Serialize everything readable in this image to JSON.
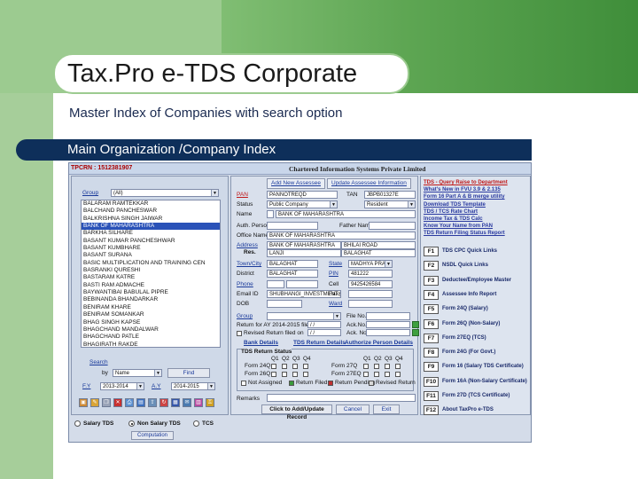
{
  "slide": {
    "title": "Tax.Pro e-TDS Corporate",
    "subtitle": "Master Index of Companies with search option",
    "section": "Main Organization /Company Index"
  },
  "app": {
    "tpcrn": "TPCRN : 1512381907",
    "company": "Chartered Information Systems Private Limited",
    "left": {
      "group_label": "Group",
      "group_value": "(All)",
      "companies": [
        "BALARAM RAMTEKKAR",
        "BALCHAND PANCHESWAR",
        "BALKRISHNA  SINGH JAIWAR",
        "BANK OF MAHARASHTRA",
        "BARKHA SILHARE",
        "BASANT KUMAR PANCHESHWAR",
        "BASANT KUMBHARE",
        "BASANT SURANA",
        "BASIC MULTIPLICATION AND TRAINING CEN",
        "BASRANKI QURESHI",
        "BASTARAM KATRE",
        "BASTI RAM ADMACHE",
        "BAYWANTIBAI BABULAL PIPRE",
        "BEBINANDA BHANDARKAR",
        "BENIRAM KHARE",
        "BENIRAM SOMANKAR",
        "BHAG SINGH KAPSE",
        "BHAGCHAND MANDALWAR",
        "BHAGCHAND PATLE",
        "BHAGIRATH RAKDE"
      ],
      "selected_index": 3,
      "search_label": "Search",
      "by_label": "by",
      "by_value": "Name",
      "find_label": "Find",
      "fy_label": "F.Y",
      "fy_value": "2013-2014",
      "ay_label": "A.Y",
      "ay_value": "2014-2015",
      "radios": [
        "Salary TDS",
        "Non Salary TDS",
        "TCS"
      ],
      "radio_selected": 1,
      "computation_label": "Computation"
    },
    "mid": {
      "tab_add": "Add New Assessee",
      "tab_update": "Update Assessee Information",
      "pan_label": "PAN",
      "pan_value": "PANNOTREQD",
      "tan_label": "TAN",
      "tan_value": "JBPB01327E",
      "status_label": "Status",
      "status_value": "Public Company",
      "resident_value": "Resident",
      "name_label": "Name",
      "name_value": "BANK OF MAHARASHTRA",
      "auth_label": "Auth. Person",
      "father_label": "Father Name",
      "office_label": "Office Name",
      "office_value": "BANK OF MAHARASHTRA",
      "address_label": "Address",
      "res_label": "Res.",
      "address_value": "BANK OF MAHARASHTRA",
      "address2_value": "BHILAI ROAD",
      "address3_value": "LANJI",
      "address4_value": "BALAGHAT",
      "town_label": "Town/City",
      "town_value": "BALAGHAT",
      "state_label": "State",
      "state_value": "MADHYA PRAD",
      "district_label": "District",
      "district_value": "BALAGHAT",
      "pin_label": "PIN",
      "pin_value": "481222",
      "phone_label": "Phone",
      "cell_label": "Cell",
      "cell_value": "9425426584",
      "email_label": "Email ID",
      "email_value": "SHUBHANGI_INVESTMENT@Y",
      "fax_label": "Fax",
      "dob_label": "DOB",
      "ward_label": "Ward",
      "group_label": "Group",
      "file_label": "File No.",
      "return_label": "Return for AY 2014-2015 filed on",
      "return_value": "/ /",
      "ack_label": "Ack.No.",
      "revised_label": "Revised Return filed on",
      "revised_value": "/ /",
      "ack2_label": "Ack. No.",
      "link_bank": "Bank Details",
      "link_tds": "TDS Return Details",
      "link_auth": "Authorize Person Details",
      "tds_status_label": "TDS Return Status",
      "q_labels": [
        "Q1",
        "Q2",
        "Q3",
        "Q4"
      ],
      "form24": "Form 24Q",
      "form26": "Form 26Q",
      "form27": "Form 27Q",
      "form27e": "Form 27EQ",
      "not_assigned": "Not Assigned",
      "return_filed": "Return Filed",
      "return_pending": "Return Pending",
      "revised_return": "Revised Return",
      "remarks_label": "Remarks",
      "btn_add": "Click to Add/Update Record",
      "btn_cancel": "Cancel",
      "btn_exit": "Exit"
    },
    "right": {
      "links": [
        {
          "text": "TDS - Query Raise to Department",
          "red": true
        },
        {
          "text": "What's New in FVU 3.9 & 2.135",
          "red": false
        },
        {
          "text": "Form 16 Part A & B merge utility",
          "red": false
        },
        {
          "text": "Download TDS Template",
          "red": false
        },
        {
          "text": "TDS / TCS Rate Chart",
          "red": false
        },
        {
          "text": "Income Tax & TDS Calc",
          "red": false
        },
        {
          "text": "Know Your Name from PAN",
          "red": false
        },
        {
          "text": "TDS Return Filing Status Report",
          "red": false
        }
      ],
      "fkeys": [
        {
          "key": "F1",
          "label": "TDS CPC Quick Links"
        },
        {
          "key": "F2",
          "label": "NSDL Quick Links"
        },
        {
          "key": "F3",
          "label": "Deductee/Employee Master"
        },
        {
          "key": "F4",
          "label": "Assessee Info Report"
        },
        {
          "key": "F5",
          "label": "Form 24Q (Salary)"
        },
        {
          "key": "F6",
          "label": "Form 26Q (Non-Salary)"
        },
        {
          "key": "F7",
          "label": "Form 27EQ (TCS)"
        },
        {
          "key": "F8",
          "label": "Form 24G (For Govt.)"
        },
        {
          "key": "F9",
          "label": "Form 16 (Salary TDS Certificate)"
        },
        {
          "key": "F10",
          "label": "Form 16A (Non-Salary Certificate)"
        },
        {
          "key": "F11",
          "label": "Form 27D (TCS Certificate)"
        },
        {
          "key": "F12",
          "label": "About TaxPro e-TDS"
        }
      ]
    }
  }
}
